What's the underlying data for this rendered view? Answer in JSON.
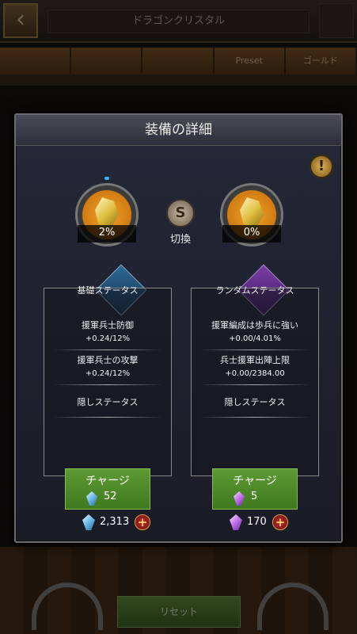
{
  "background": {
    "title": "ドラゴンクリスタル",
    "tabs": [
      "",
      "",
      "",
      "Preset",
      "ゴールド"
    ],
    "bottom_button": "リセット"
  },
  "dialog": {
    "title": "装備の詳細",
    "info_icon": "exclamation-icon",
    "slots": {
      "left_percent": "2%",
      "right_percent": "0%"
    },
    "switch_label": "切換",
    "panels": [
      {
        "title": "基礎ステータス",
        "stats": [
          {
            "name": "援軍兵士防御",
            "value": "+0.24/12%"
          },
          {
            "name": "援軍兵士の攻撃",
            "value": "+0.24/12%"
          }
        ],
        "hidden_label": "隠しステータス",
        "charge_label": "チャージ",
        "charge_cost": "52",
        "owned": "2,313",
        "gem_color": "#6ab8e8"
      },
      {
        "title": "ランダムステータス",
        "stats": [
          {
            "name": "援軍編成は歩兵に強い",
            "value": "+0.00/4.01%"
          },
          {
            "name": "兵士援軍出陣上限",
            "value": "+0.00/2384.00"
          }
        ],
        "hidden_label": "隠しステータス",
        "charge_label": "チャージ",
        "charge_cost": "5",
        "owned": "170",
        "gem_color": "#c070e8"
      }
    ]
  }
}
